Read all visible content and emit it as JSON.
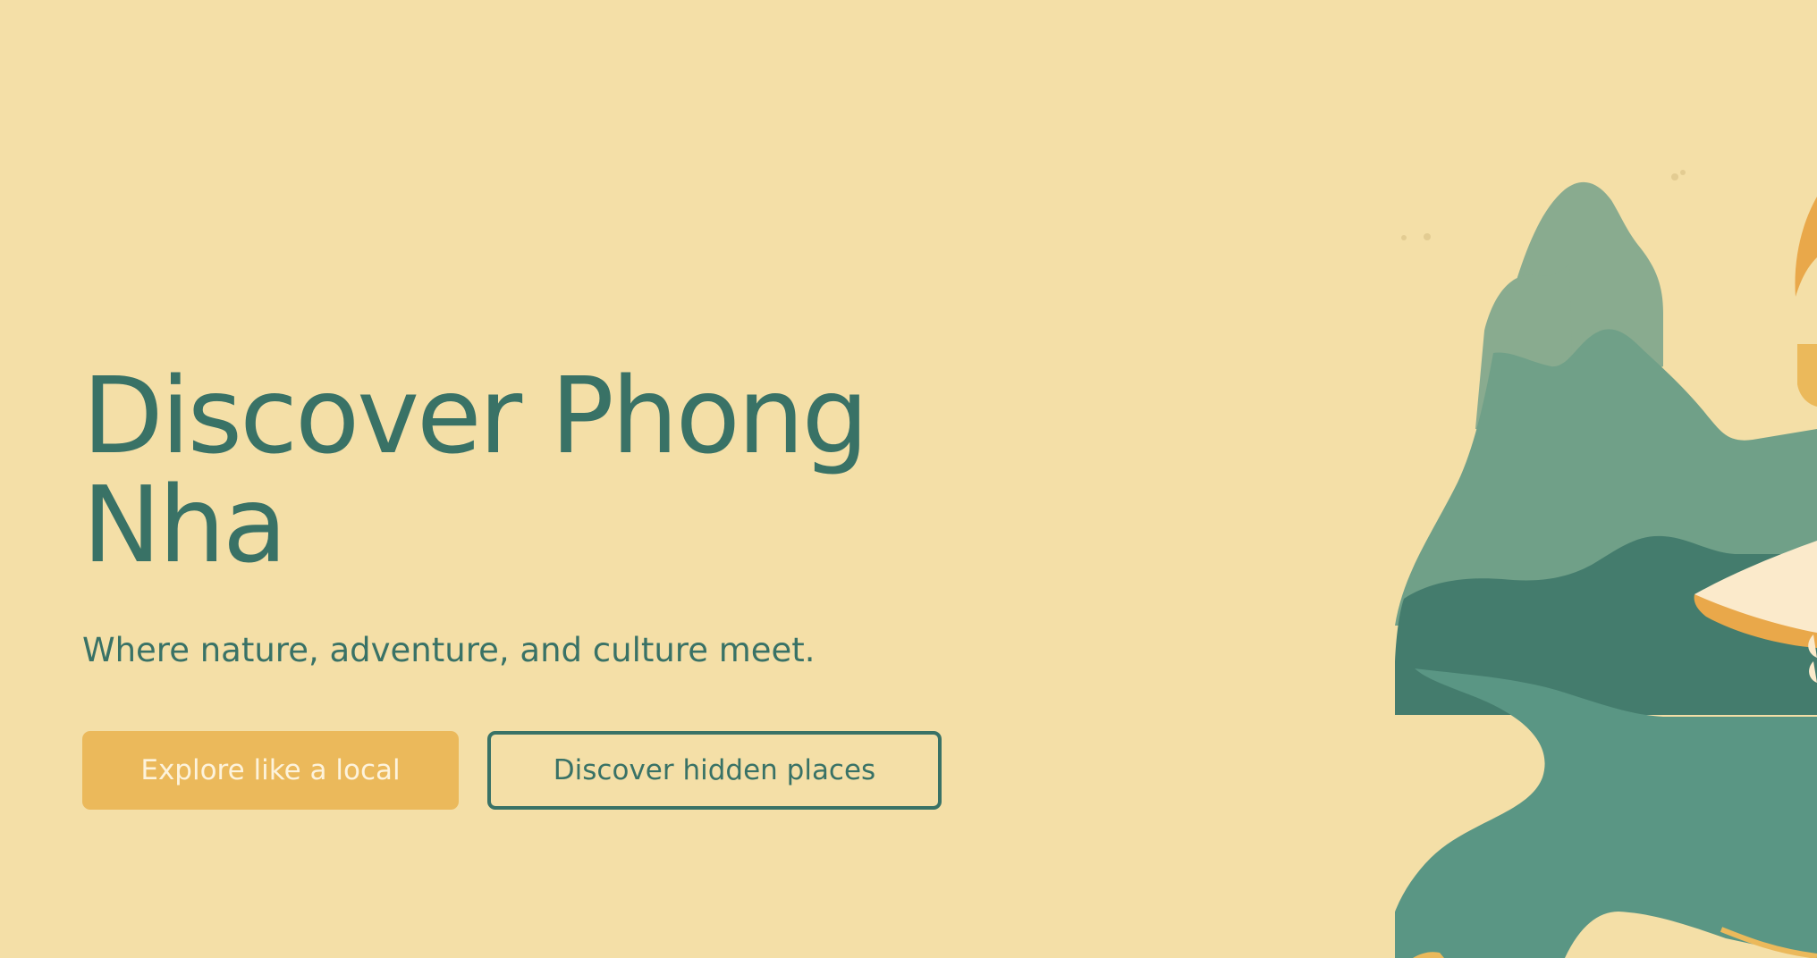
{
  "hero": {
    "title_line1": "Discover Phong",
    "title_line2": "Nha",
    "subtitle": "Where nature, adventure, and culture meet."
  },
  "cta": {
    "primary_label": "Explore like a local",
    "secondary_label": "Discover hidden places"
  },
  "colors": {
    "background": "#f4dfa7",
    "text": "#397266",
    "primary_button": "#ebb95b",
    "primary_button_text": "#fdf3dc",
    "mountain_light": "#89ab8f",
    "mountain_mid": "#70a088",
    "mountain_dark": "#447c6d",
    "water": "#5a9684",
    "accent_orange": "#e9a84a"
  }
}
